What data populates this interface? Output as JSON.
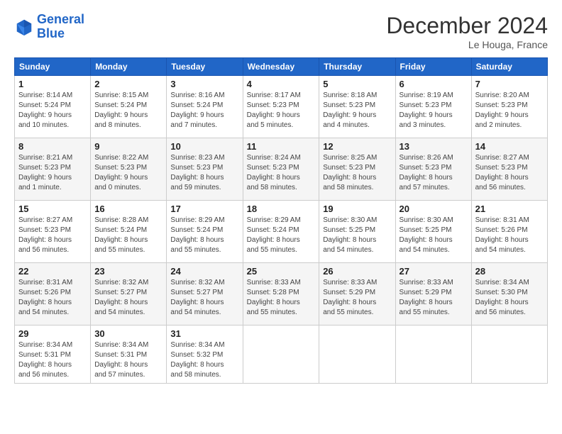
{
  "header": {
    "logo_line1": "General",
    "logo_line2": "Blue",
    "month": "December 2024",
    "location": "Le Houga, France"
  },
  "columns": [
    "Sunday",
    "Monday",
    "Tuesday",
    "Wednesday",
    "Thursday",
    "Friday",
    "Saturday"
  ],
  "weeks": [
    [
      {
        "day": "1",
        "info": "Sunrise: 8:14 AM\nSunset: 5:24 PM\nDaylight: 9 hours\nand 10 minutes."
      },
      {
        "day": "2",
        "info": "Sunrise: 8:15 AM\nSunset: 5:24 PM\nDaylight: 9 hours\nand 8 minutes."
      },
      {
        "day": "3",
        "info": "Sunrise: 8:16 AM\nSunset: 5:24 PM\nDaylight: 9 hours\nand 7 minutes."
      },
      {
        "day": "4",
        "info": "Sunrise: 8:17 AM\nSunset: 5:23 PM\nDaylight: 9 hours\nand 5 minutes."
      },
      {
        "day": "5",
        "info": "Sunrise: 8:18 AM\nSunset: 5:23 PM\nDaylight: 9 hours\nand 4 minutes."
      },
      {
        "day": "6",
        "info": "Sunrise: 8:19 AM\nSunset: 5:23 PM\nDaylight: 9 hours\nand 3 minutes."
      },
      {
        "day": "7",
        "info": "Sunrise: 8:20 AM\nSunset: 5:23 PM\nDaylight: 9 hours\nand 2 minutes."
      }
    ],
    [
      {
        "day": "8",
        "info": "Sunrise: 8:21 AM\nSunset: 5:23 PM\nDaylight: 9 hours\nand 1 minute."
      },
      {
        "day": "9",
        "info": "Sunrise: 8:22 AM\nSunset: 5:23 PM\nDaylight: 9 hours\nand 0 minutes."
      },
      {
        "day": "10",
        "info": "Sunrise: 8:23 AM\nSunset: 5:23 PM\nDaylight: 8 hours\nand 59 minutes."
      },
      {
        "day": "11",
        "info": "Sunrise: 8:24 AM\nSunset: 5:23 PM\nDaylight: 8 hours\nand 58 minutes."
      },
      {
        "day": "12",
        "info": "Sunrise: 8:25 AM\nSunset: 5:23 PM\nDaylight: 8 hours\nand 58 minutes."
      },
      {
        "day": "13",
        "info": "Sunrise: 8:26 AM\nSunset: 5:23 PM\nDaylight: 8 hours\nand 57 minutes."
      },
      {
        "day": "14",
        "info": "Sunrise: 8:27 AM\nSunset: 5:23 PM\nDaylight: 8 hours\nand 56 minutes."
      }
    ],
    [
      {
        "day": "15",
        "info": "Sunrise: 8:27 AM\nSunset: 5:23 PM\nDaylight: 8 hours\nand 56 minutes."
      },
      {
        "day": "16",
        "info": "Sunrise: 8:28 AM\nSunset: 5:24 PM\nDaylight: 8 hours\nand 55 minutes."
      },
      {
        "day": "17",
        "info": "Sunrise: 8:29 AM\nSunset: 5:24 PM\nDaylight: 8 hours\nand 55 minutes."
      },
      {
        "day": "18",
        "info": "Sunrise: 8:29 AM\nSunset: 5:24 PM\nDaylight: 8 hours\nand 55 minutes."
      },
      {
        "day": "19",
        "info": "Sunrise: 8:30 AM\nSunset: 5:25 PM\nDaylight: 8 hours\nand 54 minutes."
      },
      {
        "day": "20",
        "info": "Sunrise: 8:30 AM\nSunset: 5:25 PM\nDaylight: 8 hours\nand 54 minutes."
      },
      {
        "day": "21",
        "info": "Sunrise: 8:31 AM\nSunset: 5:26 PM\nDaylight: 8 hours\nand 54 minutes."
      }
    ],
    [
      {
        "day": "22",
        "info": "Sunrise: 8:31 AM\nSunset: 5:26 PM\nDaylight: 8 hours\nand 54 minutes."
      },
      {
        "day": "23",
        "info": "Sunrise: 8:32 AM\nSunset: 5:27 PM\nDaylight: 8 hours\nand 54 minutes."
      },
      {
        "day": "24",
        "info": "Sunrise: 8:32 AM\nSunset: 5:27 PM\nDaylight: 8 hours\nand 54 minutes."
      },
      {
        "day": "25",
        "info": "Sunrise: 8:33 AM\nSunset: 5:28 PM\nDaylight: 8 hours\nand 55 minutes."
      },
      {
        "day": "26",
        "info": "Sunrise: 8:33 AM\nSunset: 5:29 PM\nDaylight: 8 hours\nand 55 minutes."
      },
      {
        "day": "27",
        "info": "Sunrise: 8:33 AM\nSunset: 5:29 PM\nDaylight: 8 hours\nand 55 minutes."
      },
      {
        "day": "28",
        "info": "Sunrise: 8:34 AM\nSunset: 5:30 PM\nDaylight: 8 hours\nand 56 minutes."
      }
    ],
    [
      {
        "day": "29",
        "info": "Sunrise: 8:34 AM\nSunset: 5:31 PM\nDaylight: 8 hours\nand 56 minutes."
      },
      {
        "day": "30",
        "info": "Sunrise: 8:34 AM\nSunset: 5:31 PM\nDaylight: 8 hours\nand 57 minutes."
      },
      {
        "day": "31",
        "info": "Sunrise: 8:34 AM\nSunset: 5:32 PM\nDaylight: 8 hours\nand 58 minutes."
      },
      {
        "day": "",
        "info": ""
      },
      {
        "day": "",
        "info": ""
      },
      {
        "day": "",
        "info": ""
      },
      {
        "day": "",
        "info": ""
      }
    ]
  ]
}
